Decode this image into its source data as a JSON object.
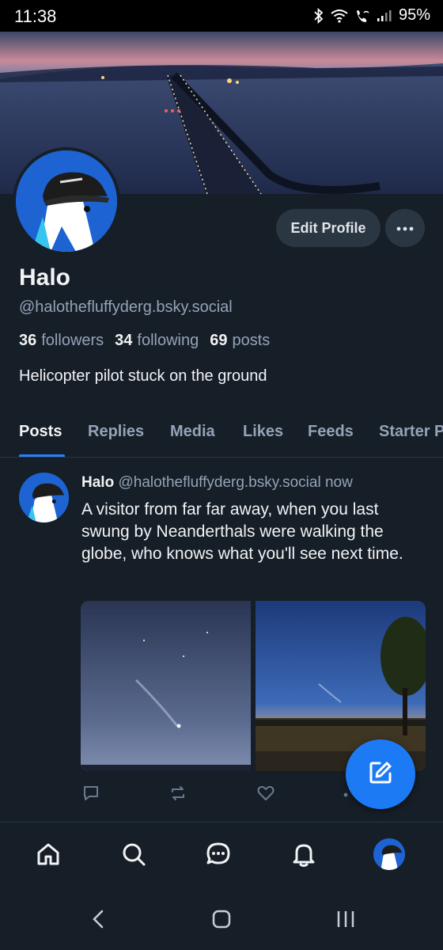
{
  "status_bar": {
    "time": "11:38",
    "battery": "95%",
    "icons": [
      "bluetooth-icon",
      "wifi-icon",
      "wifi-calling-icon",
      "signal-icon"
    ]
  },
  "profile": {
    "display_name": "Halo",
    "handle": "@halothefluffyderg.bsky.social",
    "bio": "Helicopter pilot stuck on the ground",
    "edit_label": "Edit Profile",
    "more_icon": "ellipsis-icon",
    "stats": {
      "followers_count": "36",
      "followers_label": "followers",
      "following_count": "34",
      "following_label": "following",
      "posts_count": "69",
      "posts_label": "posts"
    }
  },
  "tabs": [
    "Posts",
    "Replies",
    "Media",
    "Likes",
    "Feeds",
    "Starter Packs"
  ],
  "active_tab": "Posts",
  "post": {
    "author": "Halo",
    "handle": "@halothefluffyderg.bsky.social",
    "time": "now",
    "text": "A visitor from far far away, when you last swung by Neanderthals were walking the globe, who knows what you'll see next time."
  },
  "post_actions": [
    "reply-icon",
    "repost-icon",
    "like-icon",
    "more-icon"
  ],
  "fab_icon": "compose-icon",
  "bottom_nav": [
    "home-icon",
    "search-icon",
    "chat-icon",
    "bell-icon",
    "profile-avatar"
  ],
  "system_nav": [
    "back-icon",
    "home-button-icon",
    "recents-icon"
  ],
  "colors": {
    "background": "#161e27",
    "accent": "#1d7af5",
    "muted_text": "#94a3b8",
    "button_bg": "#2a3642"
  }
}
